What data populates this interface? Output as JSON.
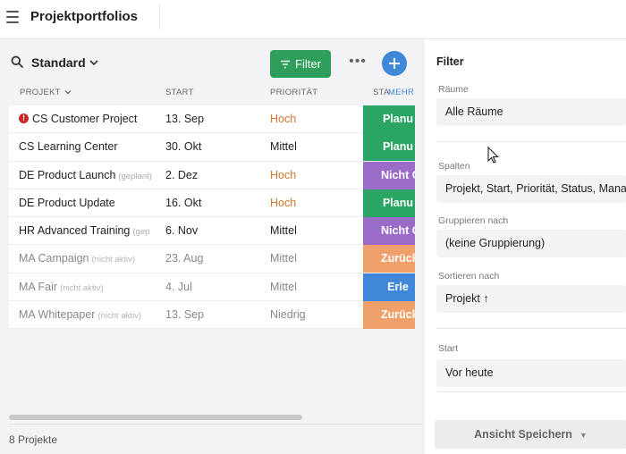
{
  "header": {
    "title": "Projektportfolios"
  },
  "view": {
    "name": "Standard",
    "filter_label": "Filter",
    "more_label": "•••"
  },
  "table": {
    "columns": {
      "project": "PROJEKT",
      "start": "START",
      "priority": "PRIORITÄT",
      "status": "STA",
      "more": "MEHR"
    },
    "rows": [
      {
        "name": "CS Customer Project",
        "sub": "",
        "start": "13. Sep",
        "priority": "Hoch",
        "status": "Planu",
        "status_color": "#2aa563",
        "alert": "!"
      },
      {
        "name": "CS Learning Center",
        "sub": "",
        "start": "30. Okt",
        "priority": "Mittel",
        "status": "Planu",
        "status_color": "#2aa563"
      },
      {
        "name": "DE Product Launch",
        "sub": "(geplant)",
        "start": "2. Dez",
        "priority": "Hoch",
        "status": "Nicht G",
        "status_color": "#9b6bc9"
      },
      {
        "name": "DE Product Update",
        "sub": "",
        "start": "16. Okt",
        "priority": "Hoch",
        "status": "Planu",
        "status_color": "#2aa563"
      },
      {
        "name": "HR Advanced Training",
        "sub": "(gep",
        "start": "6. Nov",
        "priority": "Mittel",
        "status": "Nicht G",
        "status_color": "#9b6bc9"
      },
      {
        "name": "MA Campaign",
        "sub": "(nicht aktiv)",
        "start": "23. Aug",
        "priority": "Mittel",
        "status": "Zurück",
        "status_color": "#f0a06a",
        "inactive": true
      },
      {
        "name": "MA Fair",
        "sub": "(nicht aktiv)",
        "start": "4. Jul",
        "priority": "Mittel",
        "status": "Erle",
        "status_color": "#3f88d9",
        "inactive": true
      },
      {
        "name": "MA Whitepaper",
        "sub": "(nicht aktiv)",
        "start": "13. Sep",
        "priority": "Niedrig",
        "status": "Zurück",
        "status_color": "#f0a06a",
        "inactive": true
      }
    ]
  },
  "footer": {
    "count": "8 Projekte"
  },
  "panel": {
    "title": "Filter",
    "raeume_label": "Räume",
    "raeume_value": "Alle Räume",
    "spalten_label": "Spalten",
    "spalten_value": "Projekt, Start, Priorität, Status, Manag",
    "gruppieren_label": "Gruppieren nach",
    "gruppieren_value": "(keine Gruppierung)",
    "sortieren_label": "Sortieren nach",
    "sortieren_value": "Projekt ↑",
    "start_label": "Start",
    "start_value": "Vor heute",
    "save_label": "Ansicht Speichern"
  },
  "colors": {
    "accent": "#3f88d9",
    "filter_green": "#2f9e5a",
    "priority_high": "#d3762e"
  },
  "icons": {
    "menu": "hamburger-icon",
    "search": "search-icon",
    "add": "plus-icon",
    "cursor": "mouse-pointer-icon"
  }
}
